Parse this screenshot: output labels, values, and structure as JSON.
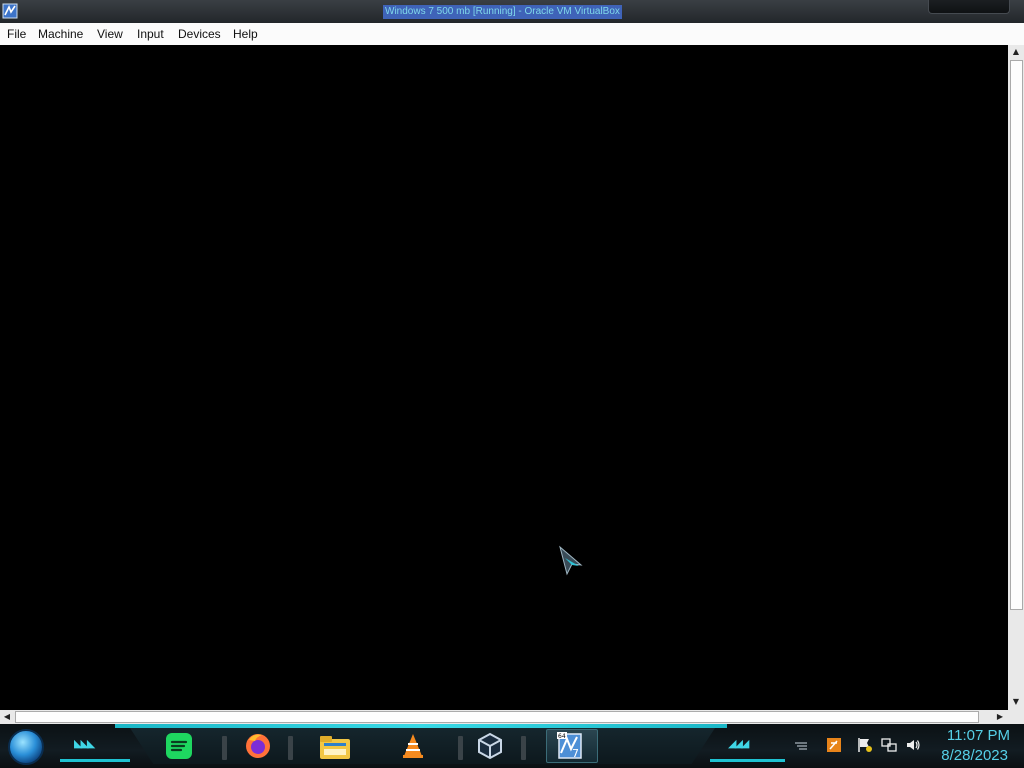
{
  "window": {
    "title": "Windows 7 500 mb [Running] - Oracle VM VirtualBox",
    "app_icon": "virtualbox-icon"
  },
  "menu": {
    "items": [
      {
        "label": "File"
      },
      {
        "label": "Machine"
      },
      {
        "label": "View"
      },
      {
        "label": "Input"
      },
      {
        "label": "Devices"
      },
      {
        "label": "Help"
      }
    ]
  },
  "guest": {
    "background_color": "#000000",
    "cursor_icon": "arrow-cursor-icon"
  },
  "taskbar": {
    "start_icon": "start-orb-icon",
    "pinned": [
      {
        "name": "spotify-icon"
      },
      {
        "name": "firefox-icon"
      },
      {
        "name": "file-explorer-icon"
      },
      {
        "name": "vlc-icon"
      },
      {
        "name": "virtualbox-icon"
      },
      {
        "name": "windows-7-vm-icon"
      }
    ],
    "tray": [
      {
        "name": "overflow-icon"
      },
      {
        "name": "app-tray-icon"
      },
      {
        "name": "action-center-flag-icon"
      },
      {
        "name": "network-icon"
      },
      {
        "name": "volume-icon"
      }
    ],
    "clock": {
      "time": "11:07 PM",
      "date": "8/28/2023"
    },
    "accent_color": "#1fc2d2"
  }
}
